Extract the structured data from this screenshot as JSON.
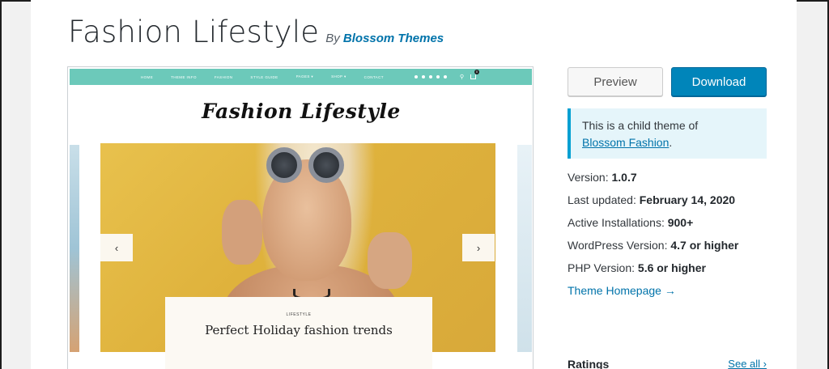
{
  "theme": {
    "title": "Fashion Lifestyle",
    "by_label": "By",
    "author": "Blossom Themes"
  },
  "screenshot": {
    "nav_items": [
      "HOME",
      "THEME INFO",
      "FASHION",
      "STYLE GUIDE",
      "PAGES ▾",
      "SHOP ▾",
      "CONTACT"
    ],
    "cart_count": "0",
    "logo_text": "Fashion Lifestyle",
    "slide_category": "LIFESTYLE",
    "slide_title": "Perfect Holiday fashion trends",
    "prev_arrow": "‹",
    "next_arrow": "›"
  },
  "actions": {
    "preview_label": "Preview",
    "download_label": "Download"
  },
  "notice": {
    "text": "This is a child theme of",
    "parent_link": "Blossom Fashion",
    "suffix": "."
  },
  "meta": {
    "version_label": "Version:",
    "version": "1.0.7",
    "updated_label": "Last updated:",
    "updated": "February 14, 2020",
    "installs_label": "Active Installations:",
    "installs": "900+",
    "wp_label": "WordPress Version:",
    "wp": "4.7 or higher",
    "php_label": "PHP Version:",
    "php": "5.6 or higher",
    "homepage_label": "Theme Homepage →"
  },
  "ratings": {
    "label": "Ratings",
    "see_all": "See all ›"
  },
  "colors": {
    "accent": "#0073aa",
    "download_bg": "#0085ba",
    "nav_teal": "#6cc9ba",
    "notice_bg": "#e5f5fa"
  }
}
